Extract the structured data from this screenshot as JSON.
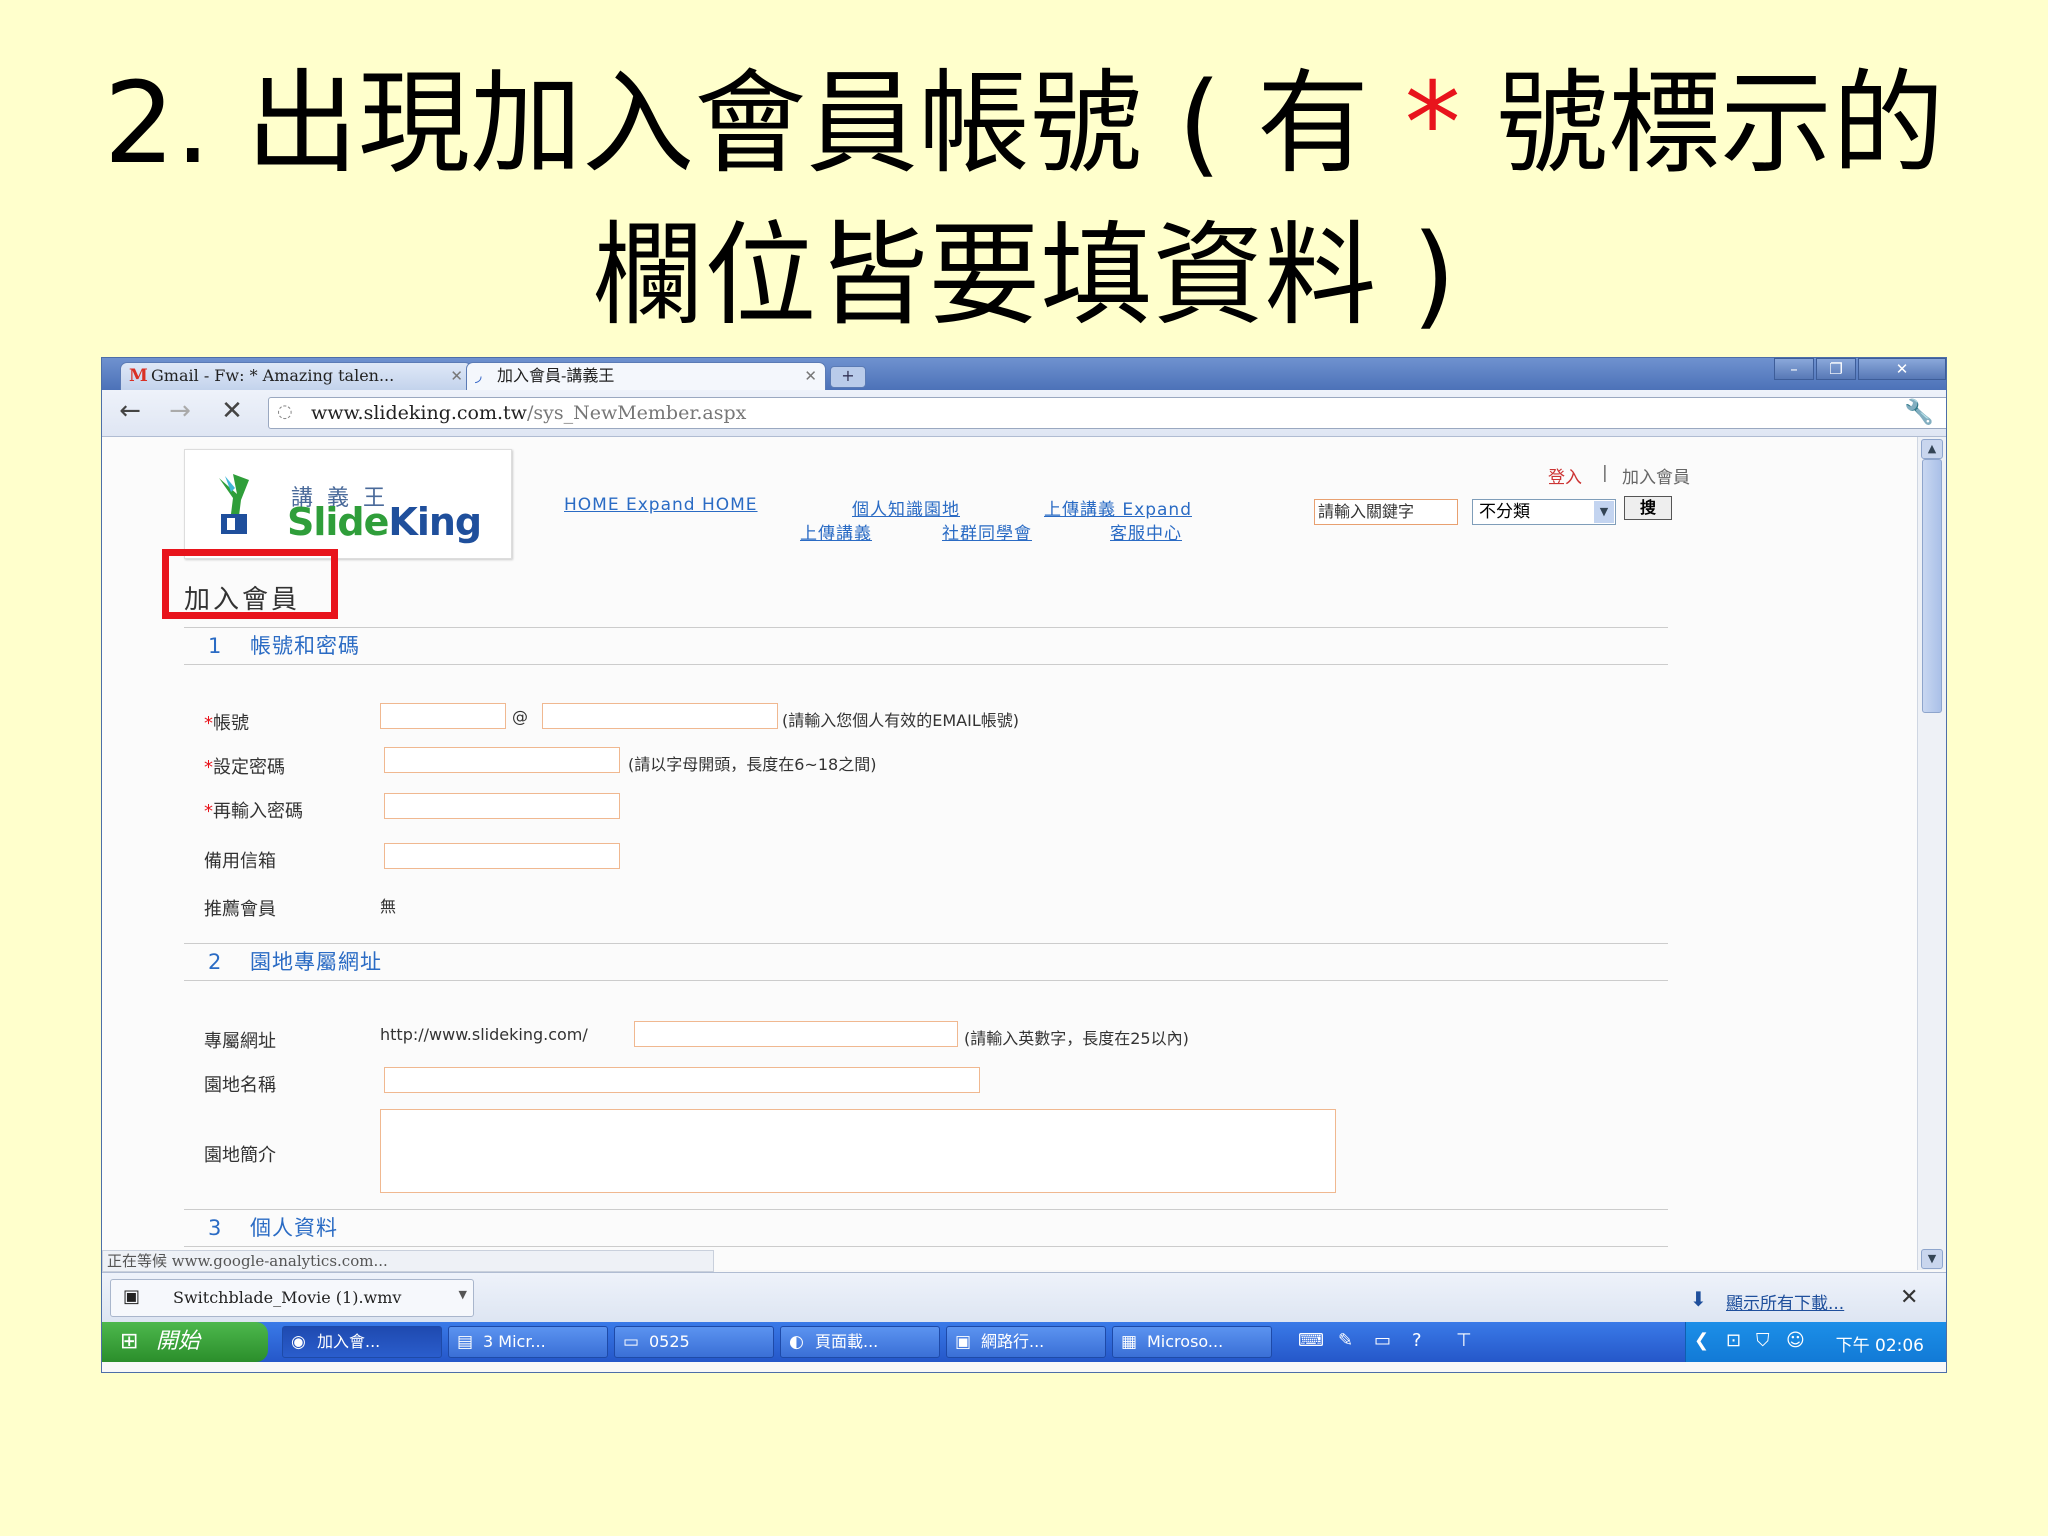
{
  "slide": {
    "title_line1_pre": "2. 出現加入會員帳號 ( 有 ",
    "title_star": "*",
    "title_line1_post": " 號標示的",
    "title_line2": "欄位皆要填資料 )",
    "accent_color": "#e8141c"
  },
  "browser": {
    "tabs": [
      {
        "label": "Gmail - Fw: * Amazing talen...",
        "icon": "gmail-icon",
        "active": false
      },
      {
        "label": "加入會員-講義王",
        "icon": "loading-icon",
        "active": true
      }
    ],
    "new_tab": "+",
    "window_buttons": [
      "–",
      "❐",
      "✕"
    ],
    "url_host": "www.slideking.com.tw",
    "url_path": "/sys_NewMember.aspx",
    "status_text": "正在等候 www.google-analytics.com...",
    "download": {
      "filename": "Switchblade_Movie (1).wmv",
      "show_all": "顯示所有下載..."
    }
  },
  "site": {
    "logo_cn": "講義王",
    "logo_en_a": "Slide",
    "logo_en_b": "King",
    "top_links": {
      "login": "登入",
      "separator": "|",
      "join": "加入會員"
    },
    "nav": {
      "row1": [
        "HOME Expand HOME",
        "個人知識園地",
        "上傳講義 Expand"
      ],
      "row2": [
        "上傳講義",
        "社群同學會",
        "客服中心"
      ]
    },
    "search": {
      "placeholder": "請輸入關鍵字",
      "category": "不分類",
      "button": "搜"
    }
  },
  "form": {
    "heading": "加入會員",
    "sections": [
      {
        "num": "1",
        "title": "帳號和密碼"
      },
      {
        "num": "2",
        "title": "園地專屬網址"
      },
      {
        "num": "3",
        "title": "個人資料"
      }
    ],
    "account": {
      "account_label": "帳號",
      "at": "@",
      "account_hint": "(請輸入您個人有效的EMAIL帳號)",
      "password_label": "設定密碼",
      "password_hint": "(請以字母開頭，長度在6~18之間)",
      "confirm_label": "再輸入密碼",
      "backup_email_label": "備用信箱",
      "referrer_label": "推薦會員",
      "referrer_value": "無",
      "required_mark": "*"
    },
    "site_url": {
      "url_label": "專屬網址",
      "url_prefix": "http://www.slideking.com/",
      "url_hint": "(請輸入英數字，長度在25以內)",
      "name_label": "園地名稱",
      "intro_label": "園地簡介"
    }
  },
  "taskbar": {
    "start": "開始",
    "items": [
      {
        "label": "加入會...",
        "icon": "chrome-icon"
      },
      {
        "label": "3 Micr...",
        "icon": "excel-icon"
      },
      {
        "label": "0525",
        "icon": "folder-icon"
      },
      {
        "label": "頁面載...",
        "icon": "firefox-icon"
      },
      {
        "label": "網路行...",
        "icon": "window-icon"
      },
      {
        "label": "Microso...",
        "icon": "powerpoint-icon"
      }
    ],
    "clock": "下午 02:06"
  }
}
